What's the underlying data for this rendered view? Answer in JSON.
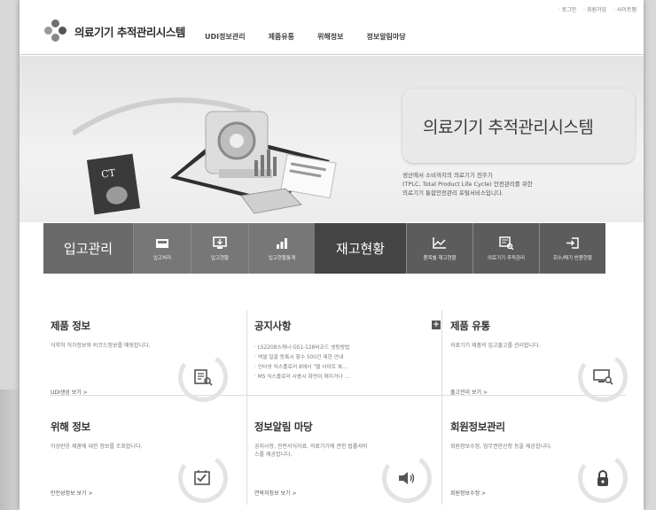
{
  "util_links": [
    "로그인",
    "회원가입",
    "사이트맵"
  ],
  "brand": {
    "title": "의료기기 추적관리시스템"
  },
  "nav": {
    "items": [
      "UDI정보관리",
      "제품유통",
      "위해정보",
      "정보알림마당"
    ]
  },
  "hero": {
    "title": "의료기기 추적관리시스템",
    "desc_line1": "생산에서 소비까지의 의료기기 전주기",
    "desc_line2": "(TPLC, Total Product Life Cycle) 안전관리를 위한",
    "desc_line3": "의료기기 통합안전관리 포털서비스입니다.",
    "ct_label": "CT"
  },
  "menu": {
    "stock_in": "입고관리",
    "stock_process": "입고처리",
    "stock_status": "입고현황",
    "stock_stats": "입고현황통계",
    "inventory": "재고현황",
    "item_inventory": "품목별 재고현황",
    "tracking": "의료기기 추적관리",
    "return": "회수/폐기 반품현황"
  },
  "cards": {
    "product_info": {
      "title": "제품 정보",
      "desc": "식약처 허가정보와 바코드정보를 매핑합니다.",
      "more": "UDI생성 보기 >"
    },
    "notice": {
      "title": "공지사항",
      "items": [
        "LS2208스캐너 GS1-128바코드 셋팅방법",
        "엑셀 일괄 등록시 항수 500건 제한 안내",
        "인터넷 익스플로러 8에서 \"웹 사이트 복...",
        "MS 익스플로러 사용시 화면이 깨지거나 ..."
      ],
      "plus": "+"
    },
    "distribution": {
      "title": "제품 유통",
      "desc": "의료기기 제품의 입고출고를 관리합니다.",
      "more": "출고관리 보기 >"
    },
    "hazard": {
      "title": "위해 정보",
      "desc": "이상반응 제품에 대한 정보를 조회합니다.",
      "more": "안전성정보 보기 >"
    },
    "info_board": {
      "title": "정보알림 마당",
      "desc": "공지사항, 관련서식자료, 의료기기에 관한 법률서비스를 제공합니다.",
      "more": "연락처정보 보기 >"
    },
    "member": {
      "title": "회원정보관리",
      "desc": "회원정보수정, 업무권한신청 등을 제공합니다.",
      "more": "회원정보수정 >"
    }
  },
  "colors": {
    "menu_bg": "#777777",
    "menu_active": "#444444",
    "hero_bg": "#ececec"
  }
}
